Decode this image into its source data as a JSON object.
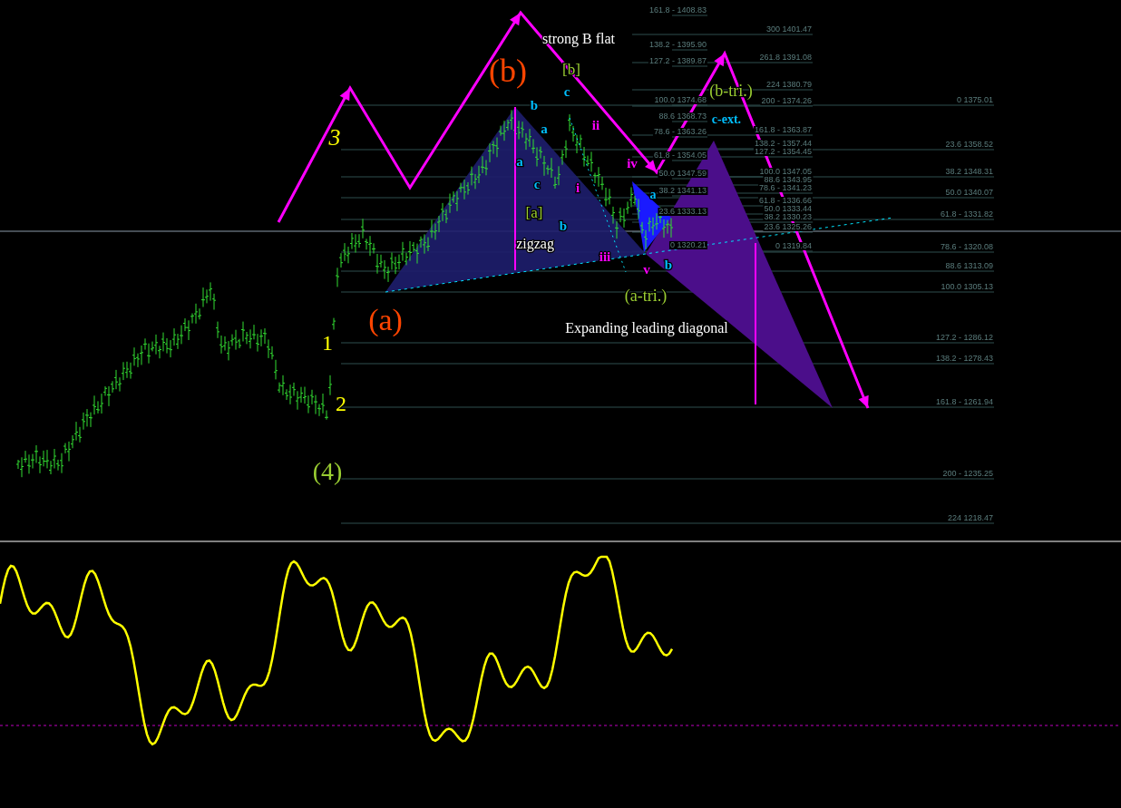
{
  "fibonacci_sets": [
    {
      "levels": [
        "161.8 -  1408.83",
        "138.2 - 1395.90",
        "127.2 - 1389.87",
        "100.0 1374.68",
        "88.6 1368.73",
        "78.6 - 1363.26",
        "61.8 - 1354.05",
        "50.0 1347.59",
        "38.2 1341.13",
        "23.6 1333.13",
        "0 1320.21"
      ]
    },
    {
      "levels": [
        "300 1401.47",
        "261.8 1391.08",
        "224 1380.79",
        "200 - 1374.26",
        "161.8 -  1363.87",
        "138.2 - 1357.44",
        "127.2 - 1354.45",
        "100.0 1347.05",
        "88.6 1343.95",
        "78.6 - 1341.23",
        "61.8 - 1336.66",
        "50.0 1333.44",
        "38.2 1330.23",
        "23.6 1325.26",
        "0 1319.84"
      ]
    },
    {
      "levels": [
        "0 1375.01",
        "23.6 1358.52",
        "38.2 1348.31",
        "50.0 1340.07",
        "61.8 - 1331.82",
        "78.6 - 1320.08",
        "88.6 1313.09",
        "100.0 1305.13",
        "127.2 - 1286.12",
        "138.2 - 1278.43",
        "161.8 -  1261.94",
        "200 - 1235.25",
        "224 1218.47"
      ]
    }
  ],
  "annotations": [
    {
      "text": "3",
      "color": "#ffff00"
    },
    {
      "text": "strong B flat",
      "color": "#ffffff"
    },
    {
      "text": "(b)",
      "color": "#ff4500"
    },
    {
      "text": "[b]",
      "color": "#9acd32"
    },
    {
      "text": "c",
      "color": "#00bfff"
    },
    {
      "text": "b",
      "color": "#00bfff"
    },
    {
      "text": "a",
      "color": "#00bfff"
    },
    {
      "text": "ii",
      "color": "#ff00ff"
    },
    {
      "text": "a",
      "color": "#00bfff"
    },
    {
      "text": "iv",
      "color": "#ff00ff"
    },
    {
      "text": "c",
      "color": "#00bfff"
    },
    {
      "text": "i",
      "color": "#ff00ff"
    },
    {
      "text": "a",
      "color": "#00bfff"
    },
    {
      "text": "[a]",
      "color": "#9acd32"
    },
    {
      "text": "b",
      "color": "#00bfff"
    },
    {
      "text": "zigzag",
      "color": "#ffffff"
    },
    {
      "text": "iii",
      "color": "#ff00ff"
    },
    {
      "text": "v",
      "color": "#ff00ff"
    },
    {
      "text": "b",
      "color": "#00bfff"
    },
    {
      "text": "(b-tri.)",
      "color": "#9acd32"
    },
    {
      "text": "c-ext.",
      "color": "#00bfff"
    },
    {
      "text": "(a-tri.)",
      "color": "#9acd32"
    },
    {
      "text": "(a)",
      "color": "#ff4500"
    },
    {
      "text": "Expanding leading diagonal",
      "color": "#ffffff"
    },
    {
      "text": "1",
      "color": "#ffff00"
    },
    {
      "text": "2",
      "color": "#ffff00"
    },
    {
      "text": "(4)",
      "color": "#9acd32"
    }
  ]
}
